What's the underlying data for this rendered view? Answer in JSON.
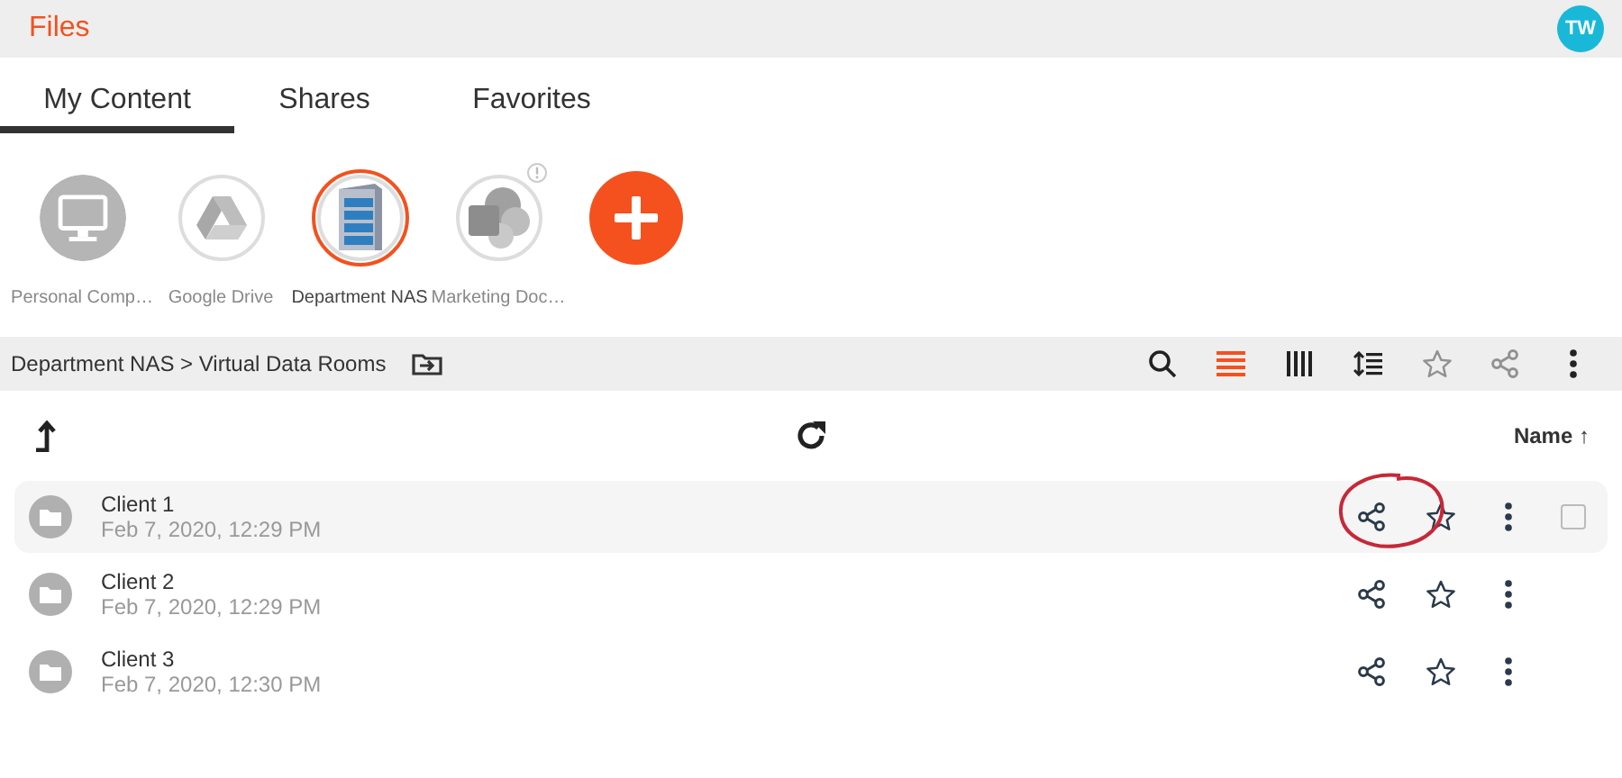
{
  "header": {
    "title": "Files",
    "avatar": "TW"
  },
  "tabs": [
    {
      "label": "My Content",
      "selected": true
    },
    {
      "label": "Shares",
      "selected": false
    },
    {
      "label": "Favorites",
      "selected": false
    }
  ],
  "storages": [
    {
      "kind": "computer",
      "label": "Personal Comp…",
      "selected": false,
      "alert": false
    },
    {
      "kind": "drive",
      "label": "Google Drive",
      "selected": false,
      "alert": false
    },
    {
      "kind": "nas",
      "label": "Department NAS",
      "selected": true,
      "alert": false
    },
    {
      "kind": "sharepoint",
      "label": "Marketing Doc…",
      "selected": false,
      "alert": true
    }
  ],
  "add_button": true,
  "breadcrumb": [
    "Department NAS",
    "Virtual Data Rooms"
  ],
  "breadcrumb_separator": ">",
  "toolbar": [
    {
      "kind": "search",
      "selected": false,
      "disabled": false
    },
    {
      "kind": "list",
      "selected": true,
      "disabled": false
    },
    {
      "kind": "columns",
      "selected": false,
      "disabled": false
    },
    {
      "kind": "sort",
      "selected": false,
      "disabled": false
    },
    {
      "kind": "star",
      "selected": false,
      "disabled": true
    },
    {
      "kind": "share",
      "selected": false,
      "disabled": true
    },
    {
      "kind": "more",
      "selected": false,
      "disabled": false
    }
  ],
  "sort": {
    "label": "Name",
    "arrow": "↑"
  },
  "rows": [
    {
      "name": "Client 1",
      "date": "Feb 7, 2020, 12:29 PM",
      "highlighted": true,
      "checked": false,
      "annotated": true
    },
    {
      "name": "Client 2",
      "date": "Feb 7, 2020, 12:29 PM",
      "highlighted": false,
      "annotated": false
    },
    {
      "name": "Client 3",
      "date": "Feb 7, 2020, 12:30 PM",
      "highlighted": false,
      "annotated": false
    }
  ]
}
